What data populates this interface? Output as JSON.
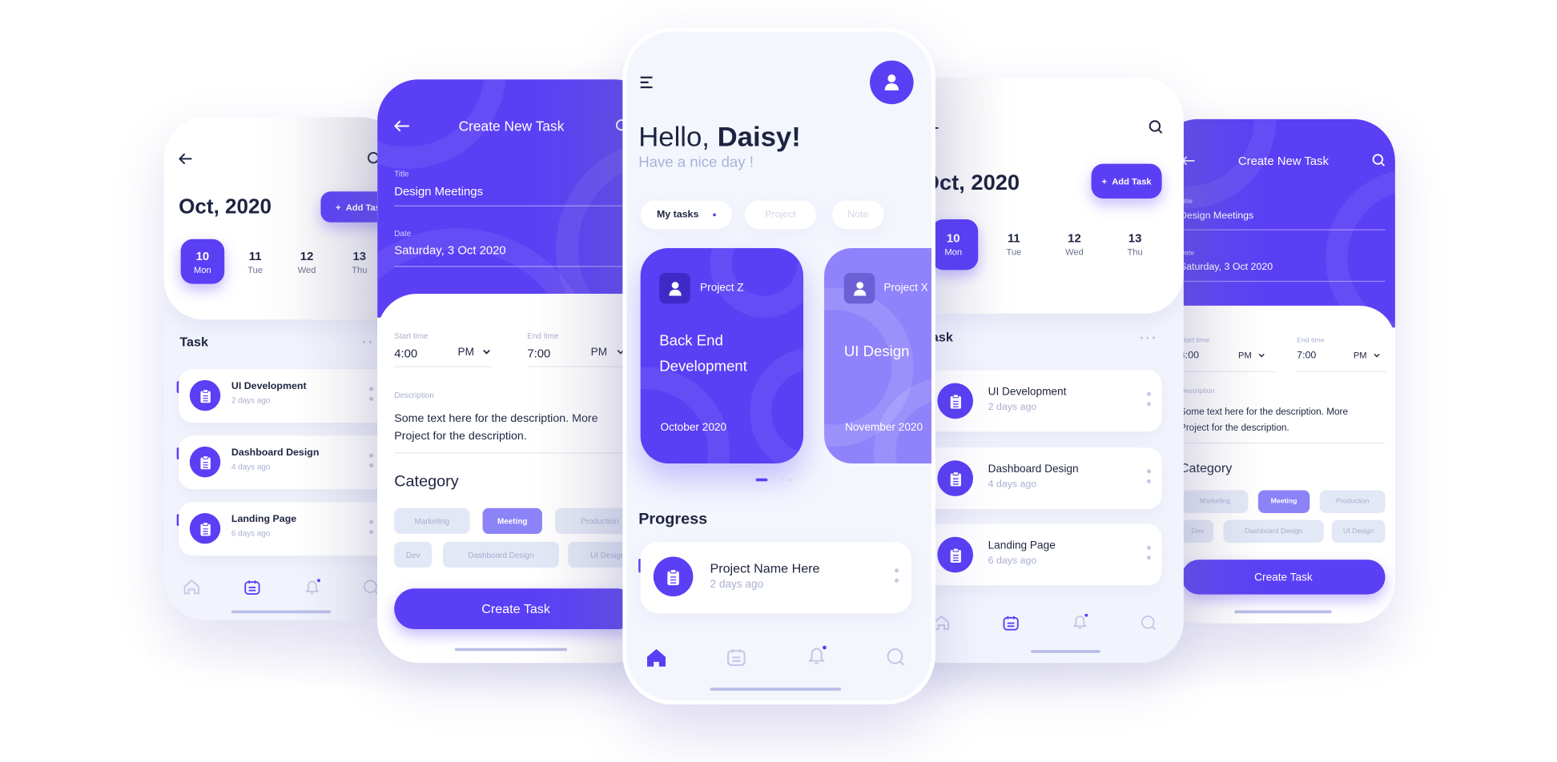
{
  "colors": {
    "accent": "#5a3ff5",
    "accent_light": "#8f82fb",
    "chip_bg": "#e3e8f6",
    "text_dark": "#1e2440",
    "text_muted": "#a9afd2"
  },
  "calendar_screen": {
    "month": "Oct, 2020",
    "add_task": "Add Task",
    "days": [
      {
        "num": "10",
        "day": "Mon",
        "selected": true
      },
      {
        "num": "11",
        "day": "Tue"
      },
      {
        "num": "12",
        "day": "Wed"
      },
      {
        "num": "13",
        "day": "Thu"
      }
    ],
    "task_heading": "Task",
    "tasks": [
      {
        "title": "UI Development",
        "time": "2 days ago"
      },
      {
        "title": "Dashboard Design",
        "time": "4 days ago"
      },
      {
        "title": "Landing Page",
        "time": "6 days ago"
      }
    ],
    "nav": [
      "home-icon",
      "calendar-icon",
      "bell-icon",
      "search-icon"
    ],
    "nav_active": "calendar-icon"
  },
  "create_screen": {
    "header_title": "Create New Task",
    "title_label": "Title",
    "title_value": "Design Meetings",
    "date_label": "Date",
    "date_value": "Saturday, 3 Oct 2020",
    "start_label": "Start time",
    "start_value": "4:00",
    "start_ampm": "PM",
    "end_label": "End time",
    "end_value": "7:00",
    "end_ampm": "PM",
    "desc_label": "Description",
    "desc_line1": "Some text here for the description. More",
    "desc_line2": "Project for the description.",
    "category_heading": "Category",
    "categories": [
      "Marketing",
      "Meeting",
      "Production",
      "Dev",
      "Dashboard Design",
      "UI Design"
    ],
    "selected_category": "Meeting",
    "submit": "Create Task"
  },
  "home_screen": {
    "greeting": "Hello, ",
    "name": "Daisy!",
    "subtitle": "Have a nice day !",
    "tabs": [
      "My tasks",
      "Project",
      "Note"
    ],
    "active_tab": "My tasks",
    "projects": [
      {
        "name": "Project Z",
        "title1": "Back End",
        "title2": "Development",
        "date": "October 2020"
      },
      {
        "name": "Project X",
        "title1": "UI Design",
        "date": "November 2020"
      }
    ],
    "carousel": {
      "pages": 4,
      "active": 1
    },
    "progress_heading": "Progress",
    "progress_item": {
      "title": "Project Name Here",
      "time": "2 days ago"
    },
    "nav": [
      "home-icon",
      "calendar-icon",
      "bell-icon",
      "search-icon"
    ],
    "nav_active": "home-icon"
  }
}
